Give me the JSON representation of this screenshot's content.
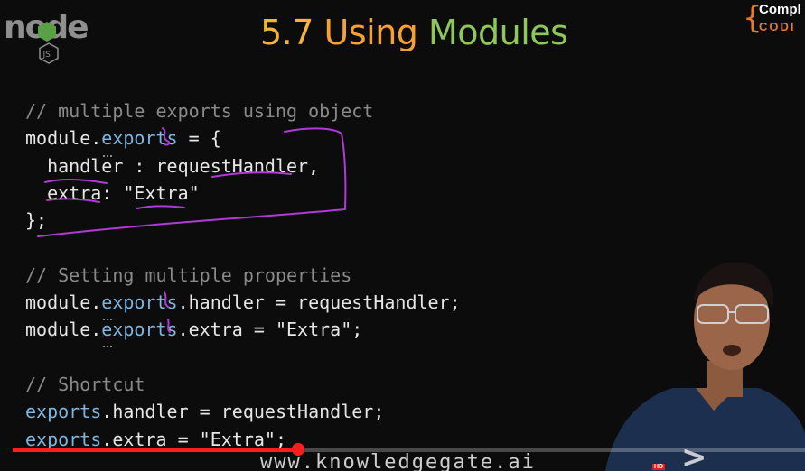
{
  "logo": {
    "text": "node",
    "badge": "JS"
  },
  "title": {
    "number": "5.7",
    "word1": "Using",
    "word2": "Modules"
  },
  "brand": {
    "line1": "Compl",
    "line2": "CODI"
  },
  "code": {
    "lines": [
      [
        {
          "t": "// multiple exports using object",
          "c": "cm"
        }
      ],
      [
        {
          "t": "module",
          "c": "p"
        },
        {
          "t": ".",
          "c": "p"
        },
        {
          "t": "exports",
          "c": "blue"
        },
        {
          "t": " = {",
          "c": "p"
        }
      ],
      [
        {
          "t": "  handler : requestHandler,",
          "c": "p"
        }
      ],
      [
        {
          "t": "  extra: ",
          "c": "p"
        },
        {
          "t": "\"Extra\"",
          "c": "str"
        }
      ],
      [
        {
          "t": "};",
          "c": "p"
        }
      ],
      [
        {
          "t": "",
          "c": "p"
        }
      ],
      [
        {
          "t": "// Setting multiple properties",
          "c": "cm"
        }
      ],
      [
        {
          "t": "module",
          "c": "p"
        },
        {
          "t": ".",
          "c": "p"
        },
        {
          "t": "exports",
          "c": "blue"
        },
        {
          "t": ".handler = requestHandler;",
          "c": "p"
        }
      ],
      [
        {
          "t": "module",
          "c": "p"
        },
        {
          "t": ".",
          "c": "p"
        },
        {
          "t": "exports",
          "c": "blue"
        },
        {
          "t": ".extra = ",
          "c": "p"
        },
        {
          "t": "\"Extra\"",
          "c": "str"
        },
        {
          "t": ";",
          "c": "p"
        }
      ],
      [
        {
          "t": "",
          "c": "p"
        }
      ],
      [
        {
          "t": "// Shortcut",
          "c": "cm"
        }
      ],
      [
        {
          "t": "exports",
          "c": "blue"
        },
        {
          "t": ".handler = requestHandler;",
          "c": "p"
        }
      ],
      [
        {
          "t": "exports",
          "c": "blue"
        },
        {
          "t": ".extra = ",
          "c": "p"
        },
        {
          "t": "\"Extra\"",
          "c": "str"
        },
        {
          "t": ";",
          "c": "p"
        }
      ]
    ]
  },
  "video": {
    "progress": 0.36,
    "website": "www.knowledgegate.ai",
    "hd_badge": "HD"
  },
  "colors": {
    "accent": "#ff1e1e",
    "title_orange": "#f3a233",
    "title_green": "#8fc85a",
    "ink": "#b03bd6"
  }
}
